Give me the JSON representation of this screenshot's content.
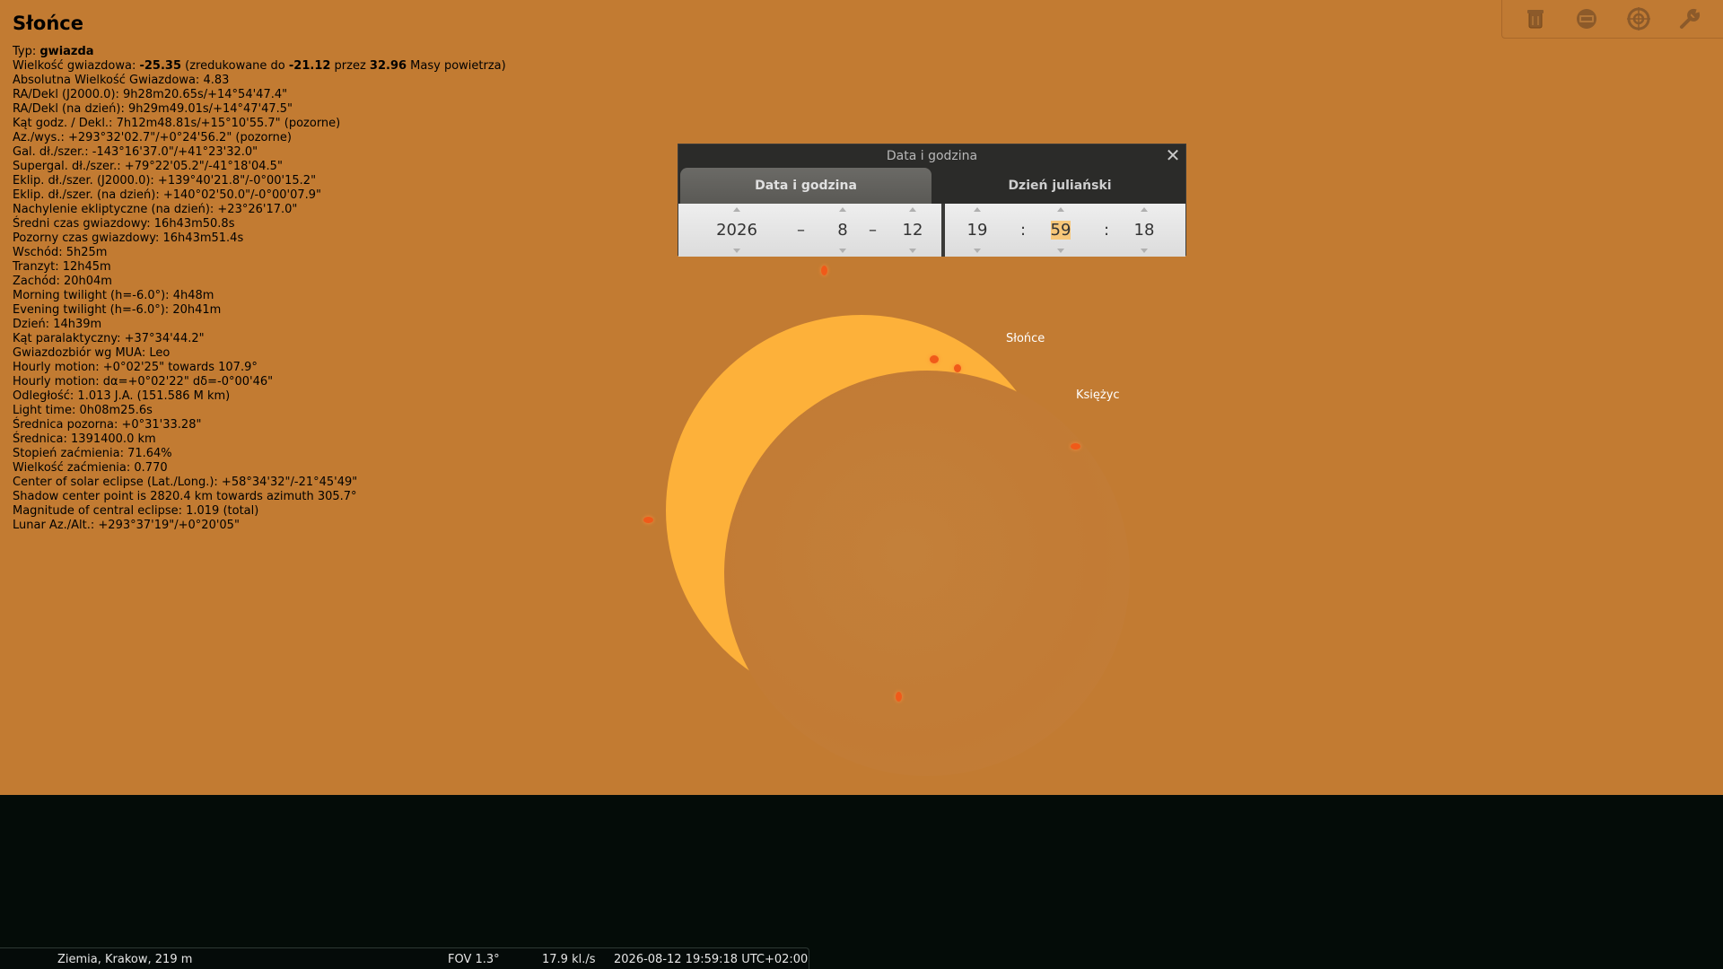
{
  "object": {
    "name": "Słońce",
    "type_label": "Typ: ",
    "type_value": "gwiazda",
    "magnitude": {
      "label": "Wielkość gwiazdowa: ",
      "value": "-25.35",
      "mid1": " (zredukowane do ",
      "reduced": "-21.12",
      "mid2": " przez ",
      "airmass": "32.96",
      "suffix": " Masy powietrza)"
    },
    "lines": [
      "Absolutna Wielkość Gwiazdowa: 4.83",
      "RA/Dekl (J2000.0): 9h28m20.65s/+14°54'47.4\"",
      "RA/Dekl (na dzień): 9h29m49.01s/+14°47'47.5\"",
      "Kąt godz. / Dekl.: 7h12m48.81s/+15°10'55.7\" (pozorne)",
      "Az./wys.: +293°32'02.7\"/+0°24'56.2\" (pozorne)",
      "Gal. dł./szer.: -143°16'37.0\"/+41°23'32.0\"",
      "Supergal. dł./szer.: +79°22'05.2\"/-41°18'04.5\"",
      "Eklip. dł./szer. (J2000.0): +139°40'21.8\"/-0°00'15.2\"",
      "Eklip. dł./szer. (na dzień): +140°02'50.0\"/-0°00'07.9\"",
      "Nachylenie ekliptyczne (na dzień): +23°26'17.0\"",
      "Średni czas gwiazdowy: 16h43m50.8s",
      "Pozorny czas gwiazdowy: 16h43m51.4s",
      "Wschód: 5h25m",
      "Tranzyt: 12h45m",
      "Zachód: 20h04m",
      "Morning twilight (h=-6.0°): 4h48m",
      "Evening twilight (h=-6.0°): 20h41m",
      "Dzień: 14h39m",
      "Kąt paralaktyczny: +37°34'44.2\"",
      "Gwiazdozbiór wg MUA: Leo",
      "Hourly motion: +0°02'25\" towards 107.9°",
      "Hourly motion: dα=+0°02'22\" dδ=-0°00'46\"",
      "Odległość: 1.013 J.A. (151.586 M km)",
      "Light time: 0h08m25.6s",
      "Średnica pozorna: +0°31'33.28\"",
      "Średnica: 1391400.0 km",
      "Stopień zaćmienia: 71.64%",
      "Wielkość zaćmienia: 0.770",
      "Center of solar eclipse (Lat./Long.): +58°34'32\"/-21°45'49\"",
      "Shadow center point is 2820.4 km towards azimuth 305.7°",
      "Magnitude of central eclipse: 1.019 (total)",
      "Lunar Az./Alt.: +293°37'19\"/+0°20'05\""
    ]
  },
  "toolbar": {
    "icons": [
      "trash-icon",
      "window-icon",
      "target-icon",
      "wrench-icon"
    ]
  },
  "sky": {
    "sun_label": "Słońce",
    "moon_label": "Księżyc",
    "colors": {
      "sky": "#c27b32",
      "sun": "#fdb13a",
      "ground": "#040c08"
    }
  },
  "dialog": {
    "title": "Data i godzina",
    "close_glyph": "✕",
    "tabs": [
      "Data i godzina",
      "Dzień juliański"
    ],
    "date": {
      "year": "2026",
      "month": "8",
      "day": "12",
      "separator": "–"
    },
    "time": {
      "hour": "19",
      "minute": "59",
      "second": "18",
      "separator": ":"
    }
  },
  "status": {
    "location": "Ziemia, Krakow, 219 m",
    "fov": "FOV 1.3°",
    "fps": "17.9 kl./s",
    "datetime": "2026-08-12 19:59:18 UTC+02:00"
  }
}
